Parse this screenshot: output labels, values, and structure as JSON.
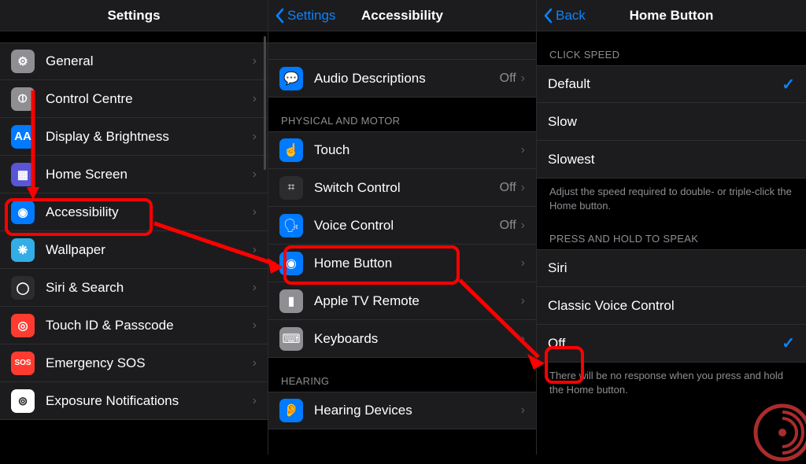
{
  "pane1": {
    "title": "Settings",
    "items": [
      {
        "label": "General",
        "icon": "gear-icon",
        "bg": "bg-gray",
        "glyph": "⚙"
      },
      {
        "label": "Control Centre",
        "icon": "sliders-icon",
        "bg": "bg-gray",
        "glyph": "⦶"
      },
      {
        "label": "Display & Brightness",
        "icon": "aa-icon",
        "bg": "bg-blue",
        "glyph": "AA"
      },
      {
        "label": "Home Screen",
        "icon": "grid-icon",
        "bg": "bg-indigo",
        "glyph": "▦"
      },
      {
        "label": "Accessibility",
        "icon": "accessibility-icon",
        "bg": "bg-blue",
        "glyph": "◉"
      },
      {
        "label": "Wallpaper",
        "icon": "flower-icon",
        "bg": "bg-teal",
        "glyph": "❋"
      },
      {
        "label": "Siri & Search",
        "icon": "siri-icon",
        "bg": "bg-black",
        "glyph": "◯"
      },
      {
        "label": "Touch ID & Passcode",
        "icon": "fingerprint-icon",
        "bg": "bg-red",
        "glyph": "◎"
      },
      {
        "label": "Emergency SOS",
        "icon": "sos-icon",
        "bg": "bg-red",
        "glyph": "SOS"
      },
      {
        "label": "Exposure Notifications",
        "icon": "exposure-icon",
        "bg": "bg-white",
        "glyph": "⊚"
      }
    ]
  },
  "pane2": {
    "back": "Settings",
    "title": "Accessibility",
    "top_item": {
      "label": "Audio Descriptions",
      "value": "Off",
      "icon": "speech-icon",
      "bg": "bg-blue",
      "glyph": "💬"
    },
    "section1_header": "PHYSICAL AND MOTOR",
    "section1_items": [
      {
        "label": "Touch",
        "value": "",
        "icon": "touch-icon",
        "bg": "bg-blue",
        "glyph": "☝"
      },
      {
        "label": "Switch Control",
        "value": "Off",
        "icon": "switch-icon",
        "bg": "bg-black",
        "glyph": "⌗"
      },
      {
        "label": "Voice Control",
        "value": "Off",
        "icon": "voice-icon",
        "bg": "bg-blue",
        "glyph": "🗣"
      },
      {
        "label": "Home Button",
        "value": "",
        "icon": "home-icon",
        "bg": "bg-blue",
        "glyph": "◉"
      },
      {
        "label": "Apple TV Remote",
        "value": "",
        "icon": "remote-icon",
        "bg": "bg-gray",
        "glyph": "▮"
      },
      {
        "label": "Keyboards",
        "value": "",
        "icon": "keyboard-icon",
        "bg": "bg-gray",
        "glyph": "⌨"
      }
    ],
    "section2_header": "HEARING",
    "section2_items": [
      {
        "label": "Hearing Devices",
        "value": "",
        "icon": "ear-icon",
        "bg": "bg-blue",
        "glyph": "👂"
      }
    ]
  },
  "pane3": {
    "back": "Back",
    "title": "Home Button",
    "section1_header": "CLICK SPEED",
    "section1_items": [
      {
        "label": "Default",
        "checked": true
      },
      {
        "label": "Slow",
        "checked": false
      },
      {
        "label": "Slowest",
        "checked": false
      }
    ],
    "section1_footer": "Adjust the speed required to double- or triple-click the Home button.",
    "section2_header": "PRESS AND HOLD TO SPEAK",
    "section2_items": [
      {
        "label": "Siri",
        "checked": false
      },
      {
        "label": "Classic Voice Control",
        "checked": false
      },
      {
        "label": "Off",
        "checked": true
      }
    ],
    "section2_footer": "There will be no response when you press and hold the Home button."
  }
}
